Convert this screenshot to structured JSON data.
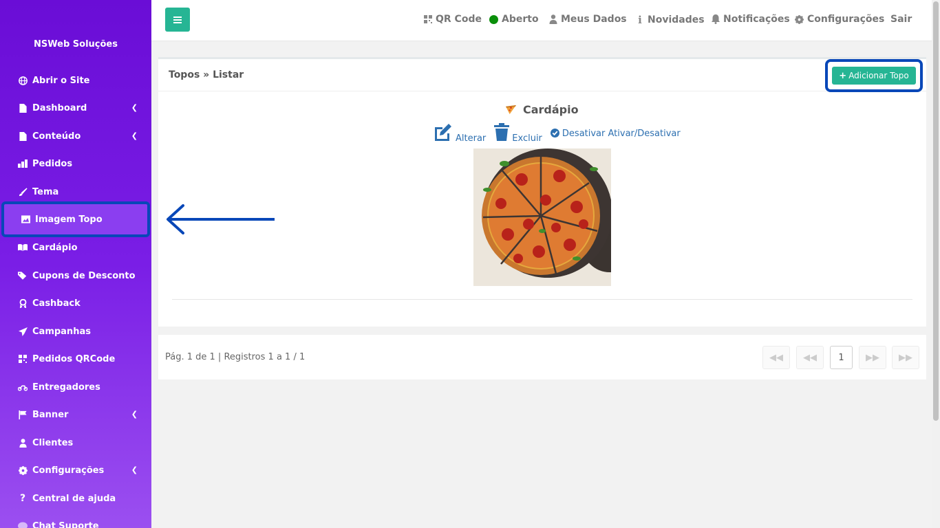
{
  "sidebar": {
    "brand": "NSWeb Soluções",
    "items": [
      {
        "label": "Abrir o Site",
        "icon": "globe-icon"
      },
      {
        "label": "Dashboard",
        "icon": "file-icon"
      },
      {
        "label": "Conteúdo",
        "icon": "file-icon"
      },
      {
        "label": "Pedidos",
        "icon": "orders-icon"
      },
      {
        "label": "Tema",
        "icon": "brush-icon"
      },
      {
        "label": "Imagem Topo",
        "icon": "image-icon"
      },
      {
        "label": "Cardápio",
        "icon": "book-icon"
      },
      {
        "label": "Cupons de Desconto",
        "icon": "tags-icon"
      },
      {
        "label": "Cashback",
        "icon": "award-icon"
      },
      {
        "label": "Campanhas",
        "icon": "send-icon"
      },
      {
        "label": "Pedidos QRCode",
        "icon": "qrcode-icon"
      },
      {
        "label": "Entregadores",
        "icon": "motorcycle-icon"
      },
      {
        "label": "Banner",
        "icon": "flag-icon"
      },
      {
        "label": "Clientes",
        "icon": "user-icon"
      },
      {
        "label": "Configurações",
        "icon": "gear-icon"
      },
      {
        "label": "Central de ajuda",
        "icon": "question-icon"
      },
      {
        "label": "Chat Suporte",
        "icon": "chat-icon"
      }
    ]
  },
  "topbar": {
    "qr_code": "QR Code",
    "aberto": "Aberto",
    "meus_dados": "Meus Dados",
    "novidades": "Novidades",
    "notificacoes": "Notificações",
    "configuracoes": "Configurações",
    "sair": "Sair"
  },
  "content": {
    "breadcrumb": "Topos » Listar",
    "add_button": "Adicionar Topo",
    "item_title": "Cardápio",
    "alterar": "Alterar",
    "excluir": "Excluir",
    "toggle": "Desativar Ativar/Desativar"
  },
  "pager": {
    "info": "Pág. 1 de 1 | Registros 1 a 1 / 1",
    "current_page": "1"
  },
  "colors": {
    "sidebar_start": "#6a0dd6",
    "accent_green": "#26b594",
    "highlight_blue": "#0847b8",
    "open_status": "#0a8f0a"
  }
}
